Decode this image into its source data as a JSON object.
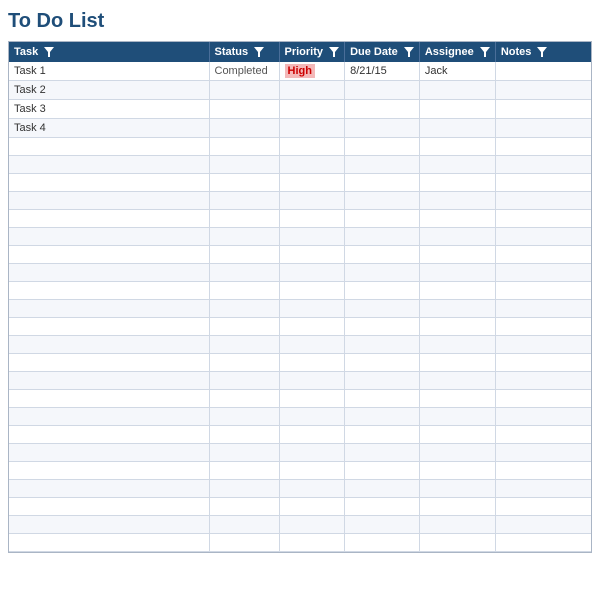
{
  "title": "To Do List",
  "columns": [
    {
      "key": "task",
      "label": "Task",
      "class": "col-task"
    },
    {
      "key": "status",
      "label": "Status",
      "class": "col-status"
    },
    {
      "key": "priority",
      "label": "Priority",
      "class": "col-priority"
    },
    {
      "key": "duedate",
      "label": "Due Date",
      "class": "col-duedate"
    },
    {
      "key": "assignee",
      "label": "Assignee",
      "class": "col-assignee"
    },
    {
      "key": "notes",
      "label": "Notes",
      "class": "col-notes"
    }
  ],
  "rows": [
    {
      "task": "Task 1",
      "status": "Completed",
      "priority": "High",
      "duedate": "8/21/15",
      "assignee": "Jack",
      "notes": ""
    },
    {
      "task": "Task 2",
      "status": "",
      "priority": "",
      "duedate": "",
      "assignee": "",
      "notes": ""
    },
    {
      "task": "Task 3",
      "status": "",
      "priority": "",
      "duedate": "",
      "assignee": "",
      "notes": ""
    },
    {
      "task": "Task 4",
      "status": "",
      "priority": "",
      "duedate": "",
      "assignee": "",
      "notes": ""
    },
    {
      "task": "",
      "status": "",
      "priority": "",
      "duedate": "",
      "assignee": "",
      "notes": ""
    },
    {
      "task": "",
      "status": "",
      "priority": "",
      "duedate": "",
      "assignee": "",
      "notes": ""
    },
    {
      "task": "",
      "status": "",
      "priority": "",
      "duedate": "",
      "assignee": "",
      "notes": ""
    },
    {
      "task": "",
      "status": "",
      "priority": "",
      "duedate": "",
      "assignee": "",
      "notes": ""
    },
    {
      "task": "",
      "status": "",
      "priority": "",
      "duedate": "",
      "assignee": "",
      "notes": ""
    },
    {
      "task": "",
      "status": "",
      "priority": "",
      "duedate": "",
      "assignee": "",
      "notes": ""
    },
    {
      "task": "",
      "status": "",
      "priority": "",
      "duedate": "",
      "assignee": "",
      "notes": ""
    },
    {
      "task": "",
      "status": "",
      "priority": "",
      "duedate": "",
      "assignee": "",
      "notes": ""
    },
    {
      "task": "",
      "status": "",
      "priority": "",
      "duedate": "",
      "assignee": "",
      "notes": ""
    },
    {
      "task": "",
      "status": "",
      "priority": "",
      "duedate": "",
      "assignee": "",
      "notes": ""
    },
    {
      "task": "",
      "status": "",
      "priority": "",
      "duedate": "",
      "assignee": "",
      "notes": ""
    },
    {
      "task": "",
      "status": "",
      "priority": "",
      "duedate": "",
      "assignee": "",
      "notes": ""
    },
    {
      "task": "",
      "status": "",
      "priority": "",
      "duedate": "",
      "assignee": "",
      "notes": ""
    },
    {
      "task": "",
      "status": "",
      "priority": "",
      "duedate": "",
      "assignee": "",
      "notes": ""
    },
    {
      "task": "",
      "status": "",
      "priority": "",
      "duedate": "",
      "assignee": "",
      "notes": ""
    },
    {
      "task": "",
      "status": "",
      "priority": "",
      "duedate": "",
      "assignee": "",
      "notes": ""
    },
    {
      "task": "",
      "status": "",
      "priority": "",
      "duedate": "",
      "assignee": "",
      "notes": ""
    },
    {
      "task": "",
      "status": "",
      "priority": "",
      "duedate": "",
      "assignee": "",
      "notes": ""
    },
    {
      "task": "",
      "status": "",
      "priority": "",
      "duedate": "",
      "assignee": "",
      "notes": ""
    },
    {
      "task": "",
      "status": "",
      "priority": "",
      "duedate": "",
      "assignee": "",
      "notes": ""
    },
    {
      "task": "",
      "status": "",
      "priority": "",
      "duedate": "",
      "assignee": "",
      "notes": ""
    },
    {
      "task": "",
      "status": "",
      "priority": "",
      "duedate": "",
      "assignee": "",
      "notes": ""
    },
    {
      "task": "",
      "status": "",
      "priority": "",
      "duedate": "",
      "assignee": "",
      "notes": ""
    }
  ]
}
